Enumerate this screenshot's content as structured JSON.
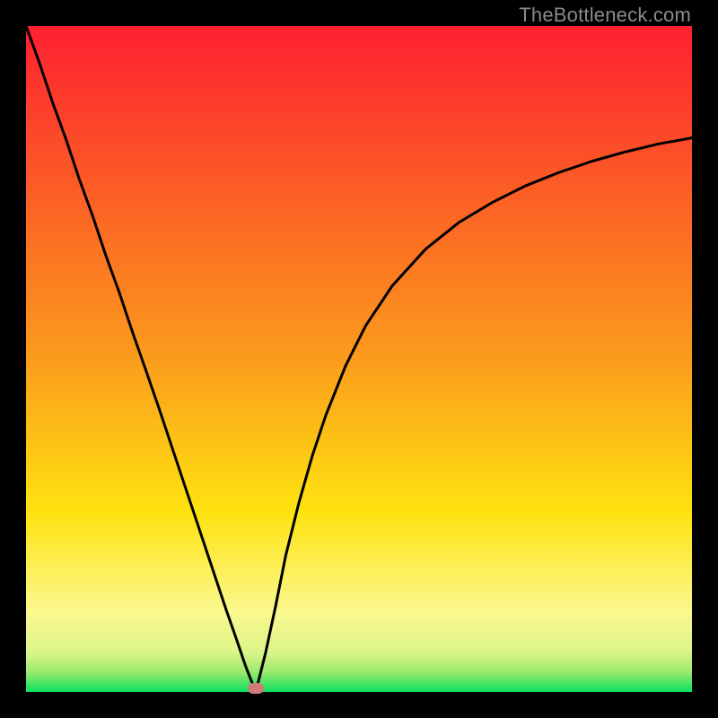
{
  "watermark": "TheBottleneck.com",
  "colors": {
    "top": "#fd2030",
    "mid": "#fee310",
    "bottom": "#08e060",
    "curve": "#000000",
    "marker": "#cf7b77",
    "border": "#000000"
  },
  "chart_data": {
    "type": "line",
    "title": "",
    "xlabel": "",
    "ylabel": "",
    "xlim": [
      0,
      1
    ],
    "ylim": [
      0,
      1
    ],
    "minimum_x": 0.345,
    "marker": {
      "x": 0.345,
      "y": 0.0
    },
    "series": [
      {
        "name": "bottleneck-curve",
        "x": [
          0.0,
          0.02,
          0.04,
          0.06,
          0.08,
          0.1,
          0.12,
          0.14,
          0.16,
          0.18,
          0.2,
          0.22,
          0.24,
          0.26,
          0.28,
          0.3,
          0.315,
          0.33,
          0.345,
          0.36,
          0.375,
          0.39,
          0.41,
          0.43,
          0.45,
          0.48,
          0.51,
          0.55,
          0.6,
          0.65,
          0.7,
          0.75,
          0.8,
          0.85,
          0.9,
          0.95,
          1.0
        ],
        "y": [
          1.0,
          0.945,
          0.885,
          0.83,
          0.77,
          0.715,
          0.655,
          0.6,
          0.54,
          0.483,
          0.425,
          0.365,
          0.305,
          0.245,
          0.185,
          0.125,
          0.082,
          0.038,
          0.0,
          0.06,
          0.13,
          0.205,
          0.285,
          0.355,
          0.415,
          0.49,
          0.55,
          0.61,
          0.665,
          0.705,
          0.735,
          0.76,
          0.78,
          0.797,
          0.811,
          0.823,
          0.832
        ]
      }
    ],
    "gradient_stops": [
      {
        "offset": 0.0,
        "color": "#fd2030"
      },
      {
        "offset": 0.5,
        "color": "#fb9c1c"
      },
      {
        "offset": 0.73,
        "color": "#fee310"
      },
      {
        "offset": 0.88,
        "color": "#faf88e"
      },
      {
        "offset": 0.94,
        "color": "#dcf58a"
      },
      {
        "offset": 0.97,
        "color": "#9be96d"
      },
      {
        "offset": 1.0,
        "color": "#08e060"
      }
    ]
  }
}
